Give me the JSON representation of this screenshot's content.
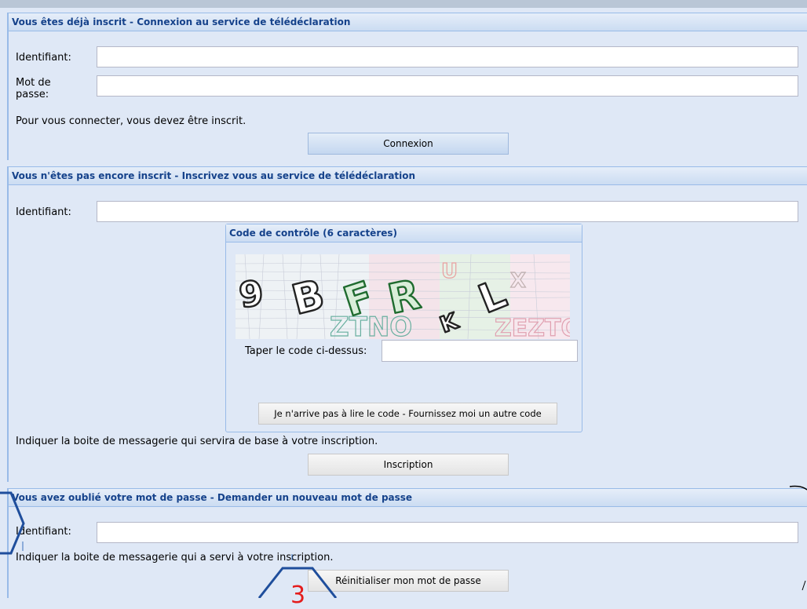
{
  "login": {
    "header": "Vous êtes déjà inscrit - Connexion au service de télédéclaration",
    "id_label": "Identifiant:",
    "pw_label": "Mot de passe:",
    "note": "Pour vous connecter, vous devez être inscrit.",
    "button": "Connexion"
  },
  "register": {
    "header": "Vous n'êtes pas encore inscrit - Inscrivez vous au service de télédéclaration",
    "id_label": "Identifiant:",
    "captcha": {
      "title": "Code de contrôle (6 caractères)",
      "type_label": "Taper le code ci-dessus:",
      "refresh_button": "Je n'arrive pas à lire le code - Fournissez moi un autre code"
    },
    "note": "Indiquer la boite de messagerie qui servira de base à votre inscription.",
    "button": "Inscription"
  },
  "forgot": {
    "header": "Vous avez oublié votre mot de passe - Demander un nouveau mot de passe",
    "id_label": "Identifiant:",
    "note": "Indiquer la boite de messagerie qui a servi à votre inscription.",
    "button": "Réinitialiser mon mot de passe"
  },
  "annotation": {
    "digit": "3"
  },
  "colors": {
    "panel_bg": "#dfe8f6",
    "header_text": "#15428b",
    "border": "#99bbe8",
    "annotation_blue": "#1f4e9c"
  }
}
